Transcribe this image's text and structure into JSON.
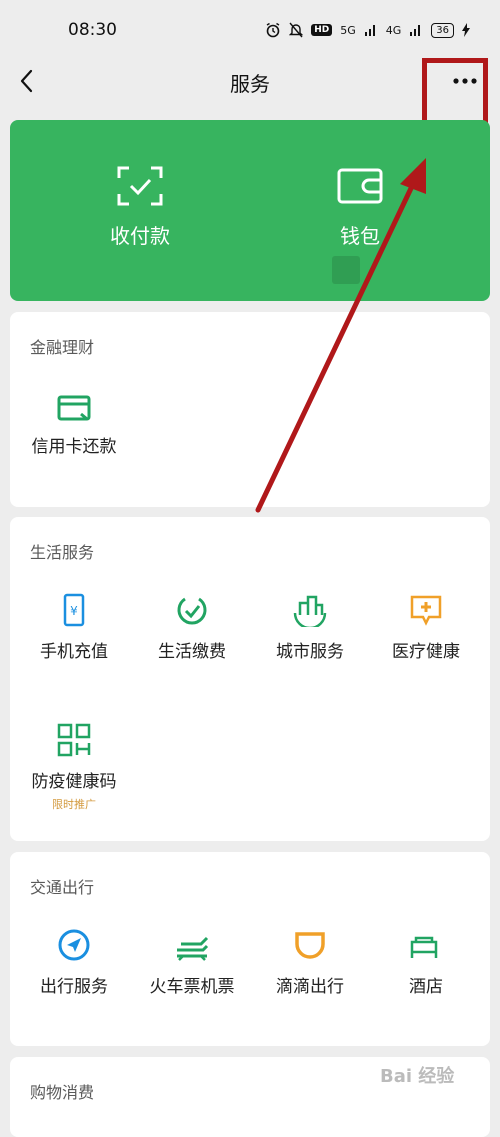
{
  "status": {
    "time": "08:30",
    "network1": "5G",
    "network2": "4G",
    "hd": "HD",
    "battery": "36"
  },
  "nav": {
    "title": "服务",
    "more": "•••"
  },
  "hero": {
    "items": [
      {
        "label": "收付款",
        "icon": "scan-pay-icon"
      },
      {
        "label": "钱包",
        "icon": "wallet-icon"
      }
    ]
  },
  "sections": [
    {
      "title": "金融理财",
      "items": [
        {
          "label": "信用卡还款",
          "icon": "credit-card-icon"
        }
      ]
    },
    {
      "title": "生活服务",
      "items": [
        {
          "label": "手机充值",
          "icon": "phone-recharge-icon"
        },
        {
          "label": "生活缴费",
          "icon": "utility-payment-icon"
        },
        {
          "label": "城市服务",
          "icon": "city-service-icon"
        },
        {
          "label": "医疗健康",
          "icon": "medical-icon"
        },
        {
          "label": "防疫健康码",
          "sub": "限时推广",
          "icon": "qr-code-icon"
        }
      ]
    },
    {
      "title": "交通出行",
      "items": [
        {
          "label": "出行服务",
          "icon": "navigation-icon"
        },
        {
          "label": "火车票机票",
          "icon": "train-icon"
        },
        {
          "label": "滴滴出行",
          "icon": "didi-icon"
        },
        {
          "label": "酒店",
          "icon": "hotel-icon"
        }
      ]
    },
    {
      "title": "购物消费",
      "items": []
    }
  ],
  "watermark": "Bai 经验",
  "colors": {
    "brand_green": "#37b45f",
    "icon_green": "#21a462",
    "icon_blue": "#1a8fe0",
    "icon_orange": "#f0a029",
    "annotation_red": "#b0181a"
  }
}
